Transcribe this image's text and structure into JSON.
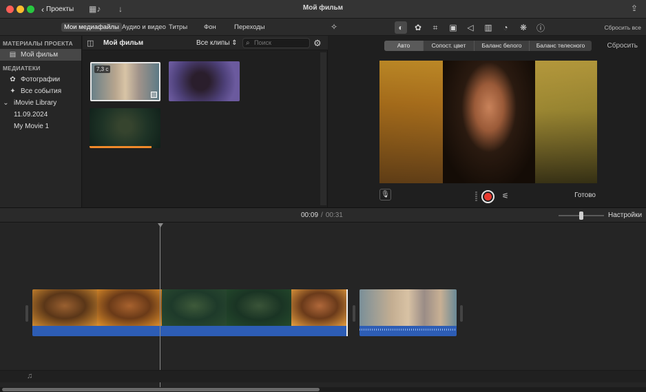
{
  "window": {
    "title": "Мой фильм",
    "back_label": "Проекты"
  },
  "toolbar": {
    "tabs": [
      {
        "label": "Мои медиафайлы",
        "active": true
      },
      {
        "label": "Аудио и видео",
        "active": false
      },
      {
        "label": "Титры",
        "active": false
      },
      {
        "label": "Фон",
        "active": false
      },
      {
        "label": "Переходы",
        "active": false
      }
    ],
    "adjust_icons": [
      "color-balance-icon",
      "color-correction-icon",
      "crop-icon",
      "stabilization-icon",
      "volume-icon",
      "noise-reduction-icon",
      "speed-icon",
      "filter-icon",
      "info-icon"
    ],
    "reset_all_label": "Сбросить все"
  },
  "sidebar": {
    "project_header": "МАТЕРИАЛЫ ПРОЕКТА",
    "project_item": "Мой фильм",
    "libraries_header": "МЕДИАТЕКИ",
    "items": [
      {
        "label": "Фотографии",
        "icon": "gear-flower-icon"
      },
      {
        "label": "Все события",
        "icon": "star-icon"
      }
    ],
    "library": "iMovie Library",
    "library_children": [
      "11.09.2024",
      "My Movie 1"
    ]
  },
  "browser": {
    "title": "Мой фильм",
    "clips_filter": "Все клипы",
    "search_placeholder": "Поиск",
    "clips": [
      {
        "badge": "7,3 с",
        "selected": true
      },
      {
        "badge": "",
        "selected": false
      },
      {
        "badge": "",
        "selected": false,
        "used_fraction": 0.87
      }
    ]
  },
  "viewer": {
    "segments": [
      "Авто",
      "Сопост. цвет",
      "Баланс белого",
      "Баланс телесного"
    ],
    "active_segment": "Авто",
    "reset_label": "Сбросить",
    "done_label": "Готово"
  },
  "timeline": {
    "current_time": "00:09",
    "separator": "/",
    "total_time": "00:31",
    "settings_label": "Настройки"
  },
  "colors": {
    "accent_orange": "#f08a2a",
    "audio_blue": "#2d5db5",
    "record_red": "#e8392e"
  }
}
